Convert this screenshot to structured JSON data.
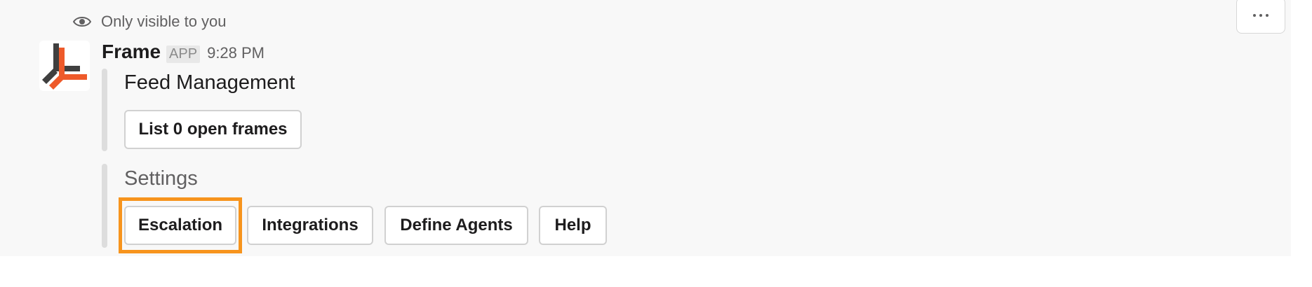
{
  "visibility": {
    "icon": "eye-icon",
    "text": "Only visible to you"
  },
  "more_actions": {
    "icon": "more-horizontal-icon"
  },
  "message": {
    "avatar_icon": "frame-logo",
    "sender": "Frame",
    "badge": "APP",
    "time": "9:28 PM"
  },
  "feed_section": {
    "title": "Feed Management",
    "button_label": "List 0 open frames"
  },
  "settings_section": {
    "title": "Settings",
    "buttons": [
      {
        "label": "Escalation"
      },
      {
        "label": "Integrations"
      },
      {
        "label": "Define Agents"
      },
      {
        "label": "Help"
      }
    ]
  },
  "colors": {
    "highlight": "#f7941d",
    "logo_dark": "#3f3f3f",
    "logo_accent": "#ee5a2a",
    "message_bg": "#f8f8f8"
  }
}
